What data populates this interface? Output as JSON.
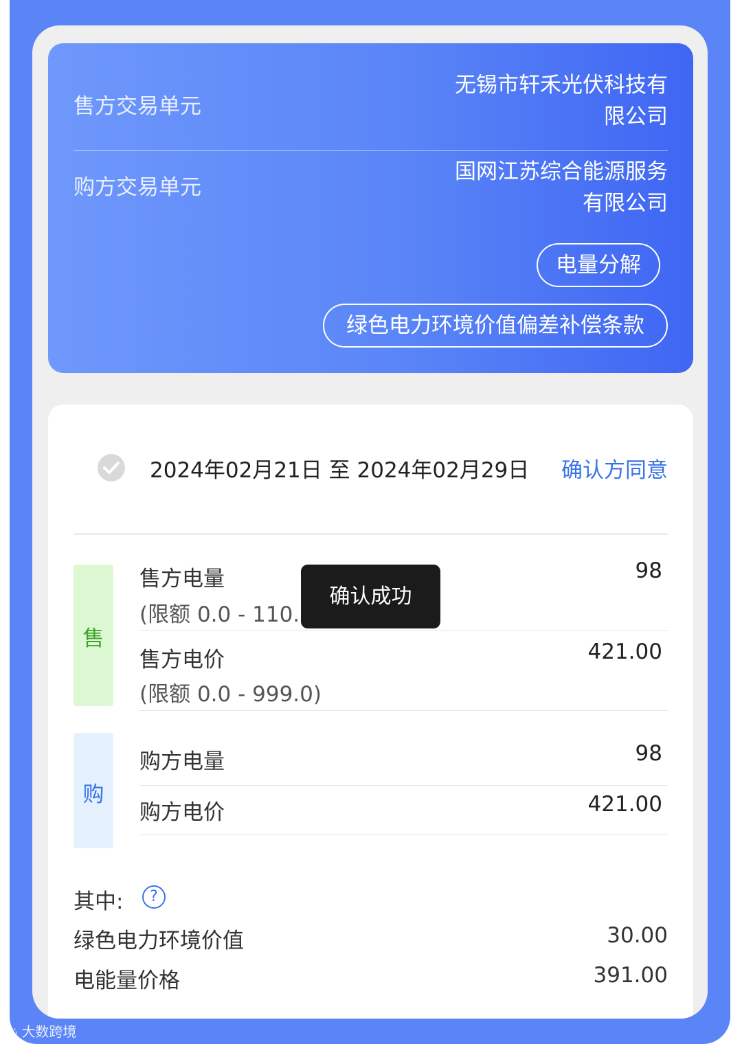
{
  "header": {
    "seller_label": "售方交易单元",
    "seller_value": "无锡市轩禾光伏科技有限公司",
    "buyer_label": "购方交易单元",
    "buyer_value": "国网江苏综合能源服务有限公司",
    "btn_breakdown": "电量分解",
    "btn_green_clause": "绿色电力环境价值偏差补偿条款"
  },
  "period": {
    "range": "2024年02月21日 至 2024年02月29日",
    "status": "确认方同意"
  },
  "sell": {
    "tag": "售",
    "qty_label": "售方电量",
    "qty_limit": "(限额 0.0 - 110.0)",
    "qty_value": "98",
    "price_label": "售方电价",
    "price_limit": "(限额 0.0 - 999.0)",
    "price_value": "421.00"
  },
  "buy": {
    "tag": "购",
    "qty_label": "购方电量",
    "qty_value": "98",
    "price_label": "购方电价",
    "price_value": "421.00"
  },
  "breakdown": {
    "title": "其中:",
    "help_icon": "?",
    "green_label": "绿色电力环境价值",
    "green_value": "30.00",
    "energy_label": "电能量价格",
    "energy_value": "391.00"
  },
  "toast": "确认成功",
  "watermark": "大数跨境",
  "colors": {
    "accent": "#3a73e8",
    "frame": "#5b84f7",
    "sell_tag_bg": "#dcf9d4",
    "sell_tag_fg": "#3fa32b",
    "buy_tag_bg": "#e6f1ff"
  }
}
